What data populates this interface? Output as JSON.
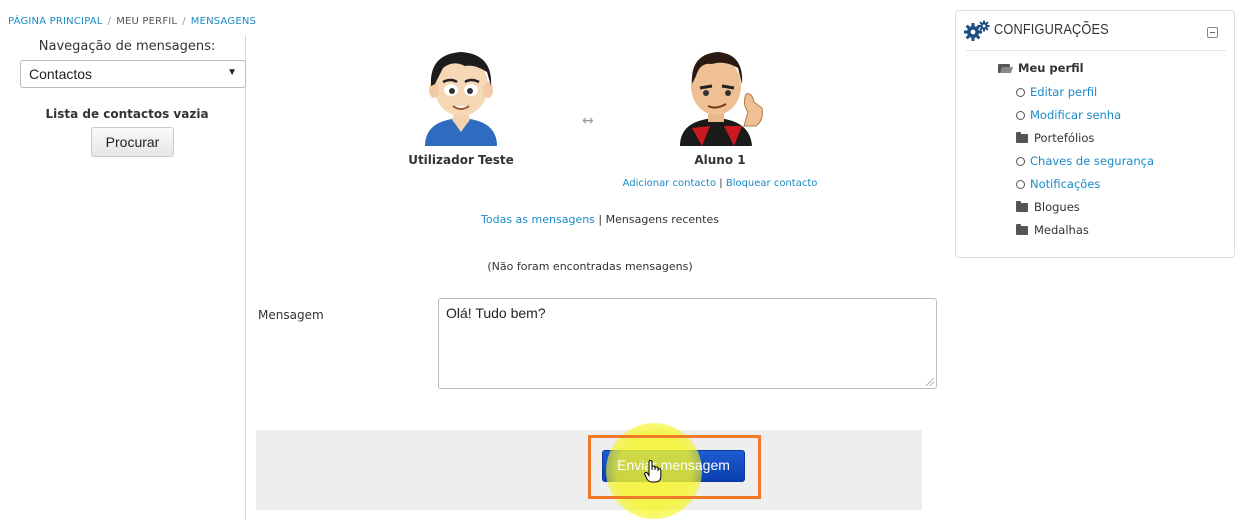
{
  "breadcrumb": {
    "items": [
      "PÁGINA PRINCIPAL",
      "MEU PERFIL",
      "MENSAGENS"
    ],
    "separator": "/"
  },
  "sidebar": {
    "nav_label": "Navegação de mensagens:",
    "select_value": "Contactos",
    "empty_list": "Lista de contactos vazia",
    "search_button": "Procurar"
  },
  "contacts": {
    "user_left": "Utilizador Teste",
    "user_right": "Aluno 1",
    "arrow_glyph": "↔",
    "add_contact": "Adicionar contacto",
    "block_contact": "Bloquear contacto",
    "link_separator": "|",
    "all_messages": "Todas as mensagens",
    "recent_messages": "Mensagens recentes",
    "no_messages": "(Não foram encontradas mensagens)"
  },
  "compose": {
    "label": "Mensagem",
    "value": "Olá! Tudo bem?",
    "send_button": "Enviar mensagem"
  },
  "settings_block": {
    "title": "CONFIGURAÇÕES",
    "root": "Meu perfil",
    "items": [
      {
        "label": "Editar perfil",
        "type": "link"
      },
      {
        "label": "Modificar senha",
        "type": "node"
      },
      {
        "label": "Portefólios",
        "type": "folder"
      },
      {
        "label": "Chaves de segurança",
        "type": "link"
      },
      {
        "label": "Notificações",
        "type": "link"
      },
      {
        "label": "Blogues",
        "type": "folder"
      },
      {
        "label": "Medalhas",
        "type": "folder"
      }
    ]
  },
  "colors": {
    "link": "#1a8bc6",
    "primary_button": "#0a3fb0",
    "highlight_frame": "#f07a28",
    "cursor_glow": "#f5f528"
  },
  "icons": [
    "gear-icon",
    "collapse-icon",
    "folder-open-icon",
    "folder-icon",
    "circle-icon",
    "hand-cursor-icon",
    "dropdown-caret-icon"
  ]
}
